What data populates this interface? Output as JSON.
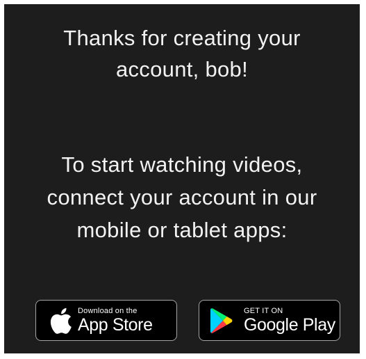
{
  "message": {
    "thanks_line1": "Thanks for creating your",
    "thanks_line2": "account, bob!",
    "instructions_line1": "To start watching videos,",
    "instructions_line2": "connect your account in our",
    "instructions_line3": "mobile or tablet apps:"
  },
  "app_store_badge": {
    "small_text": "Download on the",
    "big_text": "App Store",
    "icon": "apple-icon"
  },
  "google_play_badge": {
    "small_text": "GET IT ON",
    "big_text": "Google Play",
    "icon": "google-play-icon"
  },
  "colors": {
    "panel_background": "#1d1d1d",
    "text": "#f2f2f2",
    "badge_background": "#000000",
    "badge_border": "#a6a6a6"
  }
}
